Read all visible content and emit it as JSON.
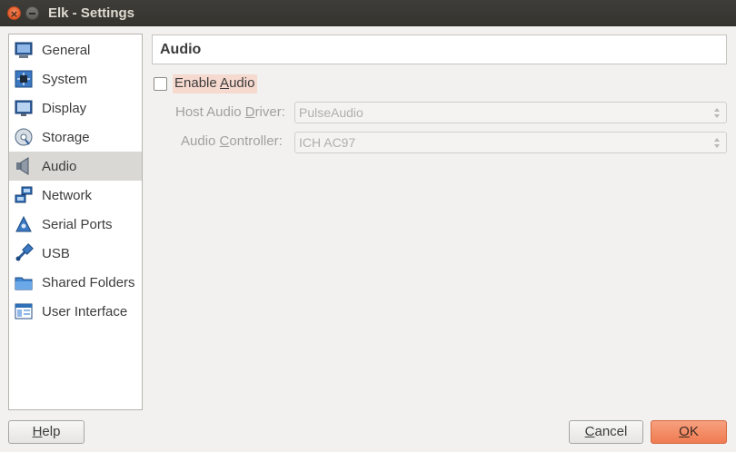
{
  "window": {
    "title": "Elk - Settings"
  },
  "sidebar": {
    "items": [
      {
        "label": "General",
        "icon": "general-icon"
      },
      {
        "label": "System",
        "icon": "system-icon"
      },
      {
        "label": "Display",
        "icon": "display-icon"
      },
      {
        "label": "Storage",
        "icon": "storage-icon"
      },
      {
        "label": "Audio",
        "icon": "audio-icon",
        "selected": true
      },
      {
        "label": "Network",
        "icon": "network-icon"
      },
      {
        "label": "Serial Ports",
        "icon": "serial-ports-icon"
      },
      {
        "label": "USB",
        "icon": "usb-icon"
      },
      {
        "label": "Shared Folders",
        "icon": "shared-folders-icon"
      },
      {
        "label": "User Interface",
        "icon": "user-interface-icon"
      }
    ]
  },
  "page": {
    "title": "Audio",
    "enable_audio": {
      "label_prefix": "Enable ",
      "label_mnemonic": "A",
      "label_suffix": "udio",
      "checked": false
    },
    "host_driver": {
      "label_prefix": "Host Audio ",
      "label_mnemonic": "D",
      "label_suffix": "river:",
      "value": "PulseAudio"
    },
    "controller": {
      "label_prefix": "Audio ",
      "label_mnemonic": "C",
      "label_suffix": "ontroller:",
      "value": "ICH AC97"
    }
  },
  "buttons": {
    "help": {
      "mnemonic": "H",
      "rest": "elp"
    },
    "cancel": {
      "mnemonic": "C",
      "rest": "ancel"
    },
    "ok": {
      "mnemonic": "O",
      "rest": "K"
    }
  },
  "colors": {
    "titlebar": "#3e3d39",
    "accent": "#ef7b51",
    "selection": "#d9d8d5",
    "highlight": "#f6d9cf"
  }
}
